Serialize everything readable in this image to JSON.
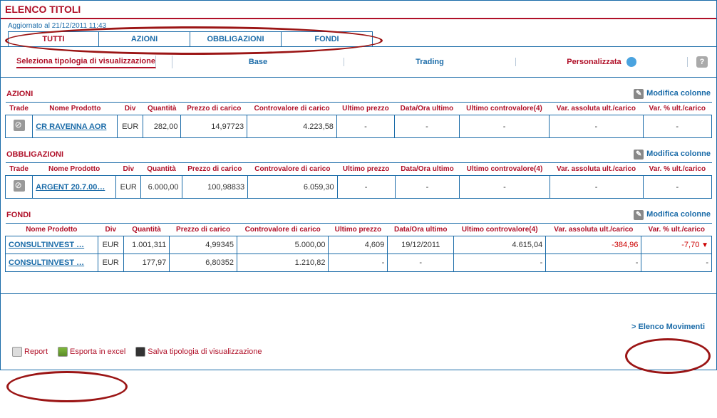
{
  "title": "ELENCO TITOLI",
  "updated": "Aggiornato al 21/12/2011 11:43",
  "tabs": [
    "TUTTI",
    "AZIONI",
    "OBBLIGAZIONI",
    "FONDI"
  ],
  "viewmodes": {
    "select_label": "Seleziona tipologia di visualizzazione",
    "base": "Base",
    "trading": "Trading",
    "custom": "Personalizzata"
  },
  "mod_col_label": "Modifica colonne",
  "sections": {
    "azioni": {
      "title": "AZIONI",
      "cols": [
        "Trade",
        "Nome Prodotto",
        "Div",
        "Quantità",
        "Prezzo di carico",
        "Controvalore di carico",
        "Ultimo prezzo",
        "Data/Ora ultimo",
        "Ultimo controvalore(4)",
        "Var. assoluta ult./carico",
        "Var. % ult./carico"
      ],
      "rows": [
        {
          "nome": "CR RAVENNA AOR",
          "div": "EUR",
          "qta": "282,00",
          "prezzo": "14,97723",
          "contro": "4.223,58",
          "ult": "-",
          "data": "-",
          "ultc": "-",
          "vabs": "-",
          "vpct": "-"
        }
      ]
    },
    "obbl": {
      "title": "OBBLIGAZIONI",
      "cols": [
        "Trade",
        "Nome Prodotto",
        "Div",
        "Quantità",
        "Prezzo di carico",
        "Controvalore di carico",
        "Ultimo prezzo",
        "Data/Ora ultimo",
        "Ultimo controvalore(4)",
        "Var. assoluta ult./carico",
        "Var. % ult./carico"
      ],
      "rows": [
        {
          "nome": "ARGENT 20.7.00…",
          "div": "EUR",
          "qta": "6.000,00",
          "prezzo": "100,98833",
          "contro": "6.059,30",
          "ult": "-",
          "data": "-",
          "ultc": "-",
          "vabs": "-",
          "vpct": "-"
        }
      ]
    },
    "fondi": {
      "title": "FONDI",
      "cols": [
        "Nome Prodotto",
        "Div",
        "Quantità",
        "Prezzo di carico",
        "Controvalore di carico",
        "Ultimo prezzo",
        "Data/Ora ultimo",
        "Ultimo controvalore(4)",
        "Var. assoluta ult./carico",
        "Var. % ult./carico"
      ],
      "rows": [
        {
          "nome": "CONSULTINVEST …",
          "div": "EUR",
          "qta": "1.001,311",
          "prezzo": "4,99345",
          "contro": "5.000,00",
          "ult": "4,609",
          "data": "19/12/2011",
          "ultc": "4.615,04",
          "vabs": "-384,96",
          "vpct": "-7,70",
          "neg": true
        },
        {
          "nome": "CONSULTINVEST …",
          "div": "EUR",
          "qta": "177,97",
          "prezzo": "6,80352",
          "contro": "1.210,82",
          "ult": "-",
          "data": "-",
          "ultc": "-",
          "vabs": "-",
          "vpct": "-"
        }
      ]
    }
  },
  "footer_link": "> Elenco Movimenti",
  "actions": {
    "report": "Report",
    "excel": "Esporta in excel",
    "save": "Salva tipologia di visualizzazione"
  }
}
